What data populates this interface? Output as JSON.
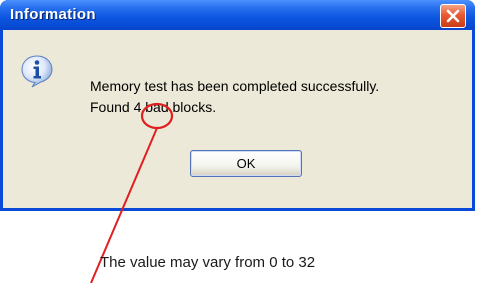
{
  "dialog": {
    "title": "Information",
    "icon": "info-icon",
    "message_line1": "Memory test has been completed successfully.",
    "message_line2": "Found 4 bad blocks.",
    "ok_label": "OK"
  },
  "annotation": {
    "text": "The value may vary from 0 to 32",
    "color": "#e02020"
  },
  "colors": {
    "titlebar": "#0b55e0",
    "close_button": "#e85a30",
    "dialog_background": "#ece9d8"
  }
}
